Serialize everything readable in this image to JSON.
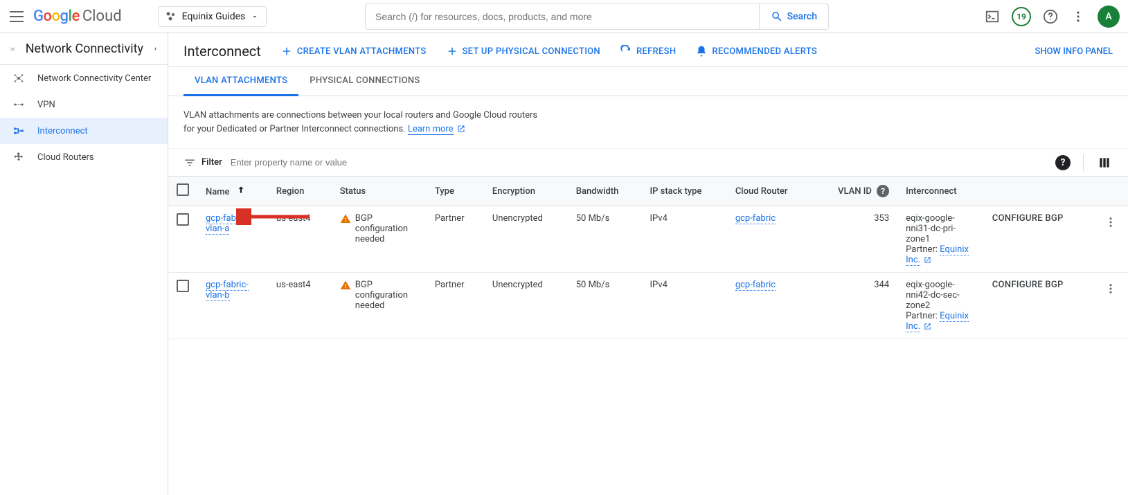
{
  "logo": {
    "google": "Google",
    "cloud": "Cloud"
  },
  "project": {
    "name": "Equinix Guides"
  },
  "search": {
    "placeholder": "Search (/) for resources, docs, products, and more",
    "button": "Search"
  },
  "trial_badge": "19",
  "avatar_letter": "A",
  "sidebar": {
    "title": "Network Connectivity",
    "items": [
      {
        "label": "Network Connectivity Center"
      },
      {
        "label": "VPN"
      },
      {
        "label": "Interconnect"
      },
      {
        "label": "Cloud Routers"
      }
    ]
  },
  "page": {
    "title": "Interconnect",
    "actions": {
      "create": "CREATE VLAN ATTACHMENTS",
      "setup": "SET UP PHYSICAL CONNECTION",
      "refresh": "REFRESH",
      "recommended": "RECOMMENDED ALERTS"
    },
    "show_info": "SHOW INFO PANEL"
  },
  "tabs": {
    "vlan": "VLAN ATTACHMENTS",
    "physical": "PHYSICAL CONNECTIONS"
  },
  "description": {
    "line1": "VLAN attachments are connections between your local routers and Google Cloud routers",
    "line2": "for your Dedicated or Partner Interconnect connections.",
    "learn": "Learn more"
  },
  "filter": {
    "label": "Filter",
    "placeholder": "Enter property name or value"
  },
  "columns": {
    "name": "Name",
    "region": "Region",
    "status": "Status",
    "type": "Type",
    "encryption": "Encryption",
    "bandwidth": "Bandwidth",
    "ipstack": "IP stack type",
    "router": "Cloud Router",
    "vlanid": "VLAN ID",
    "interconnect": "Interconnect"
  },
  "rows": [
    {
      "name": "gcp-fabric-vlan-a",
      "region": "us-east4",
      "status": "BGP configuration needed",
      "type": "Partner",
      "encryption": "Unencrypted",
      "bandwidth": "50 Mb/s",
      "ipstack": "IPv4",
      "router": "gcp-fabric",
      "vlanid": "353",
      "interconnect_line1": "eqix-google-nni31-dc-pri-zone1",
      "interconnect_partner_prefix": "Partner: ",
      "interconnect_partner": "Equinix Inc.",
      "configure": "CONFIGURE BGP"
    },
    {
      "name": "gcp-fabric-vlan-b",
      "region": "us-east4",
      "status": "BGP configuration needed",
      "type": "Partner",
      "encryption": "Unencrypted",
      "bandwidth": "50 Mb/s",
      "ipstack": "IPv4",
      "router": "gcp-fabric",
      "vlanid": "344",
      "interconnect_line1": "eqix-google-nni42-dc-sec-zone2",
      "interconnect_partner_prefix": "Partner: ",
      "interconnect_partner": "Equinix Inc.",
      "configure": "CONFIGURE BGP"
    }
  ]
}
